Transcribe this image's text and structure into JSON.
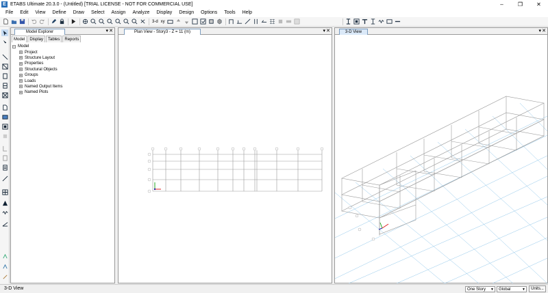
{
  "window": {
    "title": "ETABS Ultimate 20.3.0 - (Untitled)  [TRIAL LICENSE - NOT FOR COMMERCIAL USE]",
    "app_icon_letter": "E"
  },
  "menu": [
    "File",
    "Edit",
    "View",
    "Define",
    "Draw",
    "Select",
    "Assign",
    "Analyze",
    "Display",
    "Design",
    "Options",
    "Tools",
    "Help"
  ],
  "toolbar": {
    "view_3d_label": "3-d",
    "plan_label": "xy"
  },
  "model_explorer": {
    "title": "Model Explorer",
    "tabs": [
      "Model",
      "Display",
      "Tables",
      "Reports"
    ],
    "active_tab": "Model",
    "tree_root": "Model",
    "tree_items": [
      "Project",
      "Structure Layout",
      "Properties",
      "Structural Objects",
      "Groups",
      "Loads",
      "Named Output Items",
      "Named Plots"
    ]
  },
  "plan_view": {
    "title": "Plan View - Story3 - Z = 11 (m)"
  },
  "view_3d": {
    "title": "3-D View"
  },
  "status": {
    "left_text": "3-D View",
    "story_select": "One Story",
    "coord_select": "Global",
    "units_button": "Units..."
  },
  "colors": {
    "accent": "#2a6fb8",
    "grid_blue": "#8fc6ea",
    "frame_gray": "#9a9a9a"
  }
}
